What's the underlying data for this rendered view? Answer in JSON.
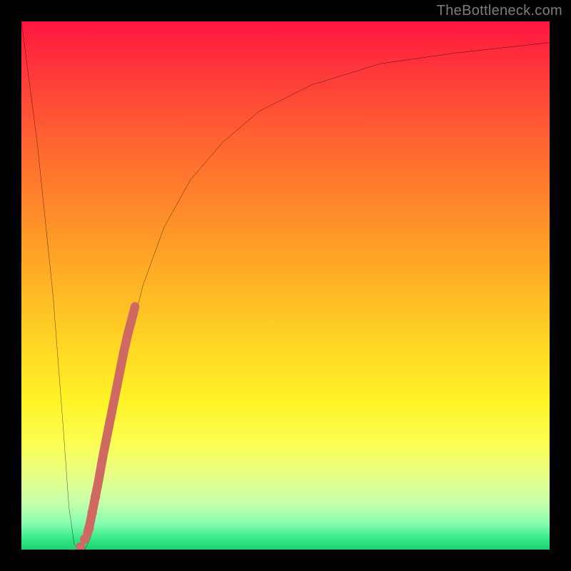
{
  "watermark": "TheBottleneck.com",
  "chart_data": {
    "type": "line",
    "title": "",
    "xlabel": "",
    "ylabel": "",
    "xlim": [
      0,
      100
    ],
    "ylim": [
      0,
      100
    ],
    "grid": false,
    "legend": false,
    "series": [
      {
        "name": "bottleneck-curve",
        "x": [
          0,
          3,
          6,
          8,
          9,
          10,
          11,
          12,
          13,
          14,
          16,
          18,
          20,
          23,
          27,
          32,
          38,
          45,
          55,
          68,
          82,
          100
        ],
        "y": [
          100,
          77,
          48,
          22,
          8,
          1,
          0,
          0,
          2,
          6,
          17,
          28,
          38,
          50,
          61,
          70,
          77,
          83,
          88,
          92,
          94,
          96
        ],
        "color": "#000000"
      }
    ],
    "highlight_segment": {
      "description": "salmon colored thick segment on rising branch",
      "x": [
        12.5,
        13.0,
        13.8,
        14.6,
        15.5,
        16.5,
        17.5,
        18.5,
        19.4,
        20.2,
        21.0,
        21.5
      ],
      "y": [
        3.0,
        5.0,
        9.0,
        13.0,
        18.0,
        23.0,
        28.0,
        33.0,
        37.5,
        41.0,
        44.0,
        46.0
      ],
      "color": "#cf6a63"
    },
    "highlight_dots": {
      "description": "salmon dots near minimum and below segment",
      "points": [
        {
          "x": 11.2,
          "y": 0.5
        },
        {
          "x": 12.0,
          "y": 2.0
        },
        {
          "x": 12.8,
          "y": 4.0
        },
        {
          "x": 13.4,
          "y": 7.0
        },
        {
          "x": 14.0,
          "y": 10.0
        }
      ],
      "color": "#cf6a63"
    },
    "background_gradient": {
      "top": "#ff163e",
      "mid": "#fff327",
      "bottom": "#1fcf72"
    }
  }
}
